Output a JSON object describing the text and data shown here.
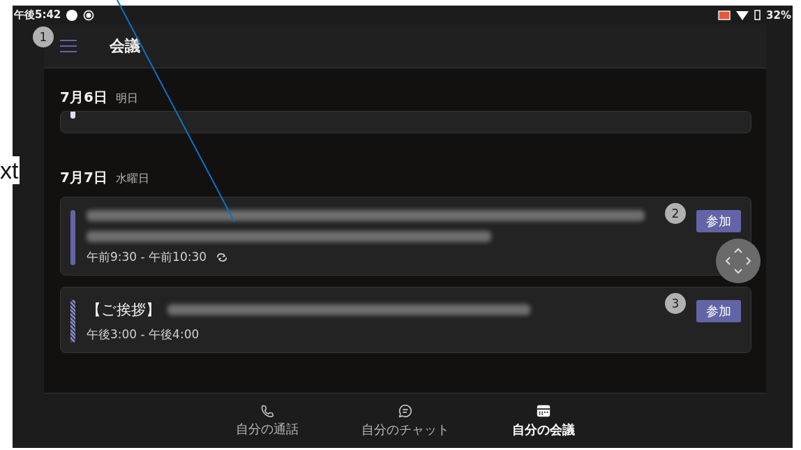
{
  "annotation": {
    "callout_text": "xt"
  },
  "status_bar": {
    "time": "午後5:42",
    "battery": "32%"
  },
  "app_bar": {
    "title": "会議",
    "marker": "1"
  },
  "sections": [
    {
      "date": "7月6日",
      "day": "明日",
      "meetings": [
        {
          "kind": "clipped"
        }
      ]
    },
    {
      "date": "7月7日",
      "day": "水曜日",
      "meetings": [
        {
          "kind": "meeting",
          "tentative": false,
          "time": "午前9:30 - 午前10:30",
          "recurring": true,
          "join_label": "参加",
          "marker": "2"
        },
        {
          "kind": "meeting",
          "tentative": true,
          "title_prefix": "【ご挨拶】",
          "time": "午後3:00 - 午後4:00",
          "recurring": false,
          "join_label": "参加",
          "marker": "3"
        }
      ]
    }
  ],
  "nav": [
    {
      "label": "自分の通話",
      "selected": false
    },
    {
      "label": "自分のチャット",
      "selected": false
    },
    {
      "label": "自分の会議",
      "selected": true
    }
  ]
}
